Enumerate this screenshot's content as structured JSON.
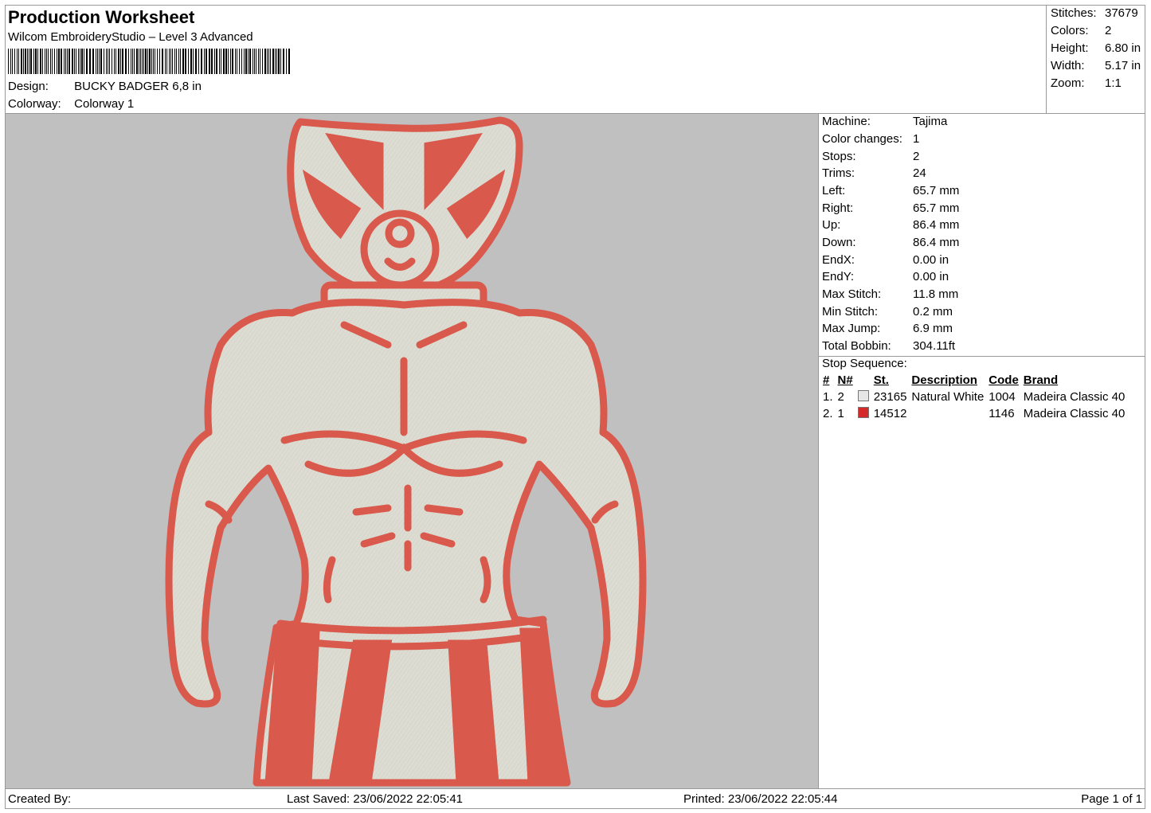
{
  "header": {
    "title": "Production Worksheet",
    "software": "Wilcom EmbroideryStudio – Level 3 Advanced",
    "design_label": "Design:",
    "design_value": "BUCKY BADGER 6,8 in",
    "colorway_label": "Colorway:",
    "colorway_value": "Colorway 1"
  },
  "summary": [
    {
      "label": "Stitches:",
      "value": "37679"
    },
    {
      "label": "Colors:",
      "value": "2"
    },
    {
      "label": "Height:",
      "value": "6.80 in"
    },
    {
      "label": "Width:",
      "value": "5.17 in"
    },
    {
      "label": "Zoom:",
      "value": "1:1"
    }
  ],
  "machine_info": [
    {
      "label": "Machine:",
      "value": "Tajima"
    },
    {
      "label": "Color changes:",
      "value": "1"
    },
    {
      "label": "Stops:",
      "value": "2"
    },
    {
      "label": "Trims:",
      "value": "24"
    },
    {
      "label": "Left:",
      "value": "65.7 mm"
    },
    {
      "label": "Right:",
      "value": "65.7 mm"
    },
    {
      "label": "Up:",
      "value": "86.4 mm"
    },
    {
      "label": "Down:",
      "value": "86.4 mm"
    },
    {
      "label": "EndX:",
      "value": "0.00 in"
    },
    {
      "label": "EndY:",
      "value": "0.00 in"
    },
    {
      "label": "Max Stitch:",
      "value": "11.8 mm"
    },
    {
      "label": "Min Stitch:",
      "value": "0.2 mm"
    },
    {
      "label": "Max Jump:",
      "value": "6.9 mm"
    },
    {
      "label": "Total Bobbin:",
      "value": "304.11ft"
    }
  ],
  "stop_sequence": {
    "title": "Stop Sequence:",
    "columns": [
      "#",
      "N#",
      "St.",
      "Description",
      "Code",
      "Brand"
    ],
    "rows": [
      {
        "idx": "1.",
        "n": "2",
        "color": "#e6e6e6",
        "st": "23165",
        "description": "Natural White",
        "code": "1004",
        "brand": "Madeira Classic 40"
      },
      {
        "idx": "2.",
        "n": "1",
        "color": "#d42a2a",
        "st": "14512",
        "description": "",
        "code": "1146",
        "brand": "Madeira Classic 40"
      }
    ]
  },
  "footer": {
    "created_by": "Created By:",
    "last_saved": "Last Saved: 23/06/2022 22:05:41",
    "printed": "Printed: 23/06/2022 22:05:44",
    "page": "Page 1 of 1"
  },
  "colors": {
    "background": "#c0c0c0",
    "thread_red": "#d9594c",
    "thread_white": "#dcdcd2"
  }
}
